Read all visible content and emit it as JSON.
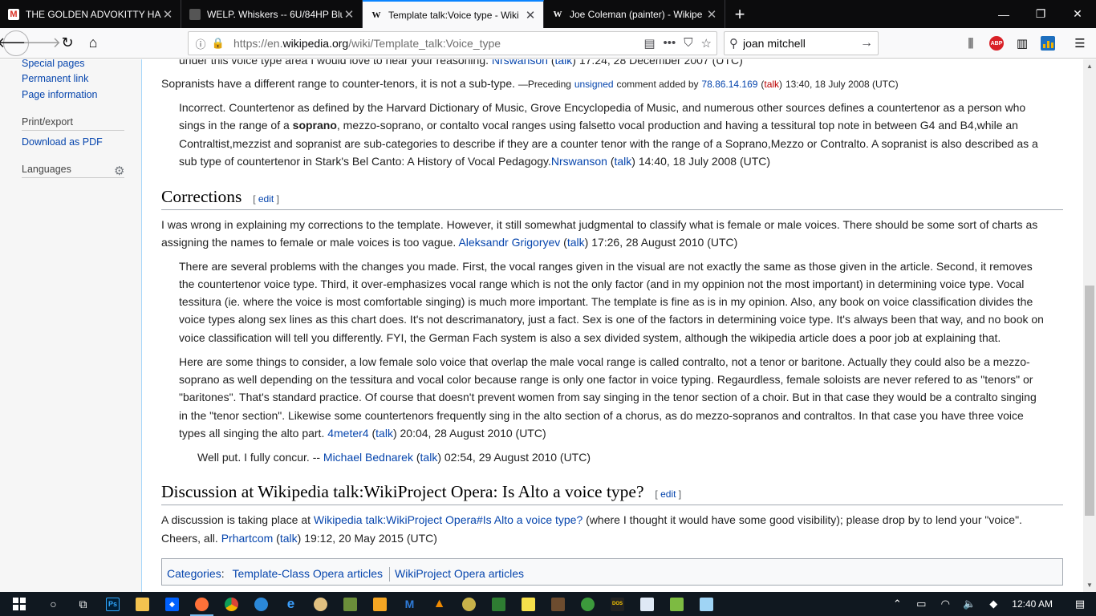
{
  "browser": {
    "tabs": [
      {
        "title": "THE GOLDEN ADVOKITTY HAS",
        "icon": "gmail-icon",
        "active": false
      },
      {
        "title": "WELP. Whiskers -- 6U/84HP Blu",
        "icon": "site-icon",
        "active": false
      },
      {
        "title": "Template talk:Voice type - Wiki",
        "icon": "wikipedia-icon",
        "active": true
      },
      {
        "title": "Joe Coleman (painter) - Wikipe",
        "icon": "wikipedia-icon",
        "active": false
      }
    ],
    "new_tab": "+",
    "url_prefix": "https://en.",
    "url_domain": "wikipedia.org",
    "url_path": "/wiki/Template_talk:Voice_type",
    "search_value": "joan mitchell",
    "page_actions": "•••"
  },
  "sidebar": {
    "tools": [
      "Special pages",
      "Permanent link",
      "Page information"
    ],
    "print_heading": "Print/export",
    "print_items": [
      "Download as PDF"
    ],
    "languages_heading": "Languages"
  },
  "content": {
    "top_partial": {
      "text": "under this voice type area I would love to hear your reasoning.",
      "user": "Nrswanson",
      "talk": "talk",
      "stamp": "17:24, 28 December 2007 (UTC)"
    },
    "sopranists": {
      "text": "Sopranists have a different range to counter-tenors, it is not a sub-type.",
      "preceding": "—Preceding",
      "unsigned": "unsigned",
      "comment_added": "comment added by",
      "ip": "78.86.14.169",
      "talk": "talk",
      "stamp": "13:40, 18 July 2008 (UTC)"
    },
    "incorrect": {
      "line1": "Incorrect. Countertenor as defined by the Harvard Dictionary of Music, Grove Encyclopedia of Music, and numerous other sources defines a countertenor as a person who",
      "line2a": "sings in the range of a",
      "bold": "soprano",
      "line2b": ", mezzo-soprano, or contalto vocal ranges using falsetto vocal production and having a tessitural top note in between G4 and B4,while an",
      "line3": "Contraltist,mezzist and sopranist are sub-categories to describe if they are a counter tenor with the range of a Soprano,Mezzo or Contralto. A sopranist is also described as a",
      "line4": "sub type of countertenor in Stark's Bel Canto: A History of Vocal Pedagogy.",
      "user": "Nrswanson",
      "talk": "talk",
      "stamp": "14:40, 18 July 2008 (UTC)"
    },
    "corrections": {
      "heading": "Corrections",
      "edit": "edit",
      "p1_line1": "I was wrong in explaining my corrections to the template. However, it still somewhat judgmental to classify what is female or male voices. There should be some sort of charts as",
      "p1_line2": "assigning the names to female or male voices is too vague.",
      "p1_user": "Aleksandr Grigoryev",
      "p1_talk": "talk",
      "p1_stamp": "17:26, 28 August 2010 (UTC)",
      "p2_lines": [
        "There are several problems with the changes you made. First, the vocal ranges given in the visual are not exactly the same as those given in the article. Second, it removes",
        "the countertenor voice type. Third, it over-emphasizes vocal range which is not the only factor (and in my oppinion not the most important) in determining voice type. Vocal",
        "tessitura (ie. where the voice is most comfortable singing) is much more important. The template is fine as is in my opinion. Also, any book on voice classification divides the",
        "voice types along sex lines as this chart does. It's not descrimanatory, just a fact. Sex is one of the factors in determining voice type. It's always been that way, and no book on",
        "voice classification will tell you differently. FYI, the German Fach system is also a sex divided system, although the wikipedia article does a poor job at explaining that."
      ],
      "p3_lines": [
        "Here are some things to consider, a low female solo voice that overlap the male vocal range is called contralto, not a tenor or baritone. Actually they could also be a mezzo-",
        "soprano as well depending on the tessitura and vocal color because range is only one factor in voice typing. Regaurdless, female soloists are never refered to as \"tenors\" or",
        "\"baritones\". That's standard practice. Of course that doesn't prevent women from say singing in the tenor section of a choir. But in that case they would be a contralto singing",
        "in the \"tenor section\". Likewise some countertenors frequently sing in the alto section of a chorus, as do mezzo-sopranos and contraltos. In that case you have three voice"
      ],
      "p3_last": "types all singing the alto part.",
      "p3_user": "4meter4",
      "p3_talk": "talk",
      "p3_stamp": "20:04, 28 August 2010 (UTC)",
      "p4_text": "Well put. I fully concur. --",
      "p4_user": "Michael Bednarek",
      "p4_talk": "talk",
      "p4_stamp": "02:54, 29 August 2010 (UTC)"
    },
    "discussion": {
      "heading": "Discussion at Wikipedia talk:WikiProject Opera: Is Alto a voice type?",
      "edit": "edit",
      "lead": "A discussion is taking place at",
      "link": "Wikipedia talk:WikiProject Opera#Is Alto a voice type?",
      "rest": "(where I thought it would have some good visibility); please drop by to lend your \"voice\".",
      "cheers": "Cheers, all.",
      "user": "Prhartcom",
      "talk": "talk",
      "stamp": "19:12, 20 May 2015 (UTC)"
    },
    "categories": {
      "label": "Categories",
      "items": [
        "Template-Class Opera articles",
        "WikiProject Opera articles"
      ]
    }
  },
  "taskbar": {
    "clock": "12:40 AM"
  }
}
